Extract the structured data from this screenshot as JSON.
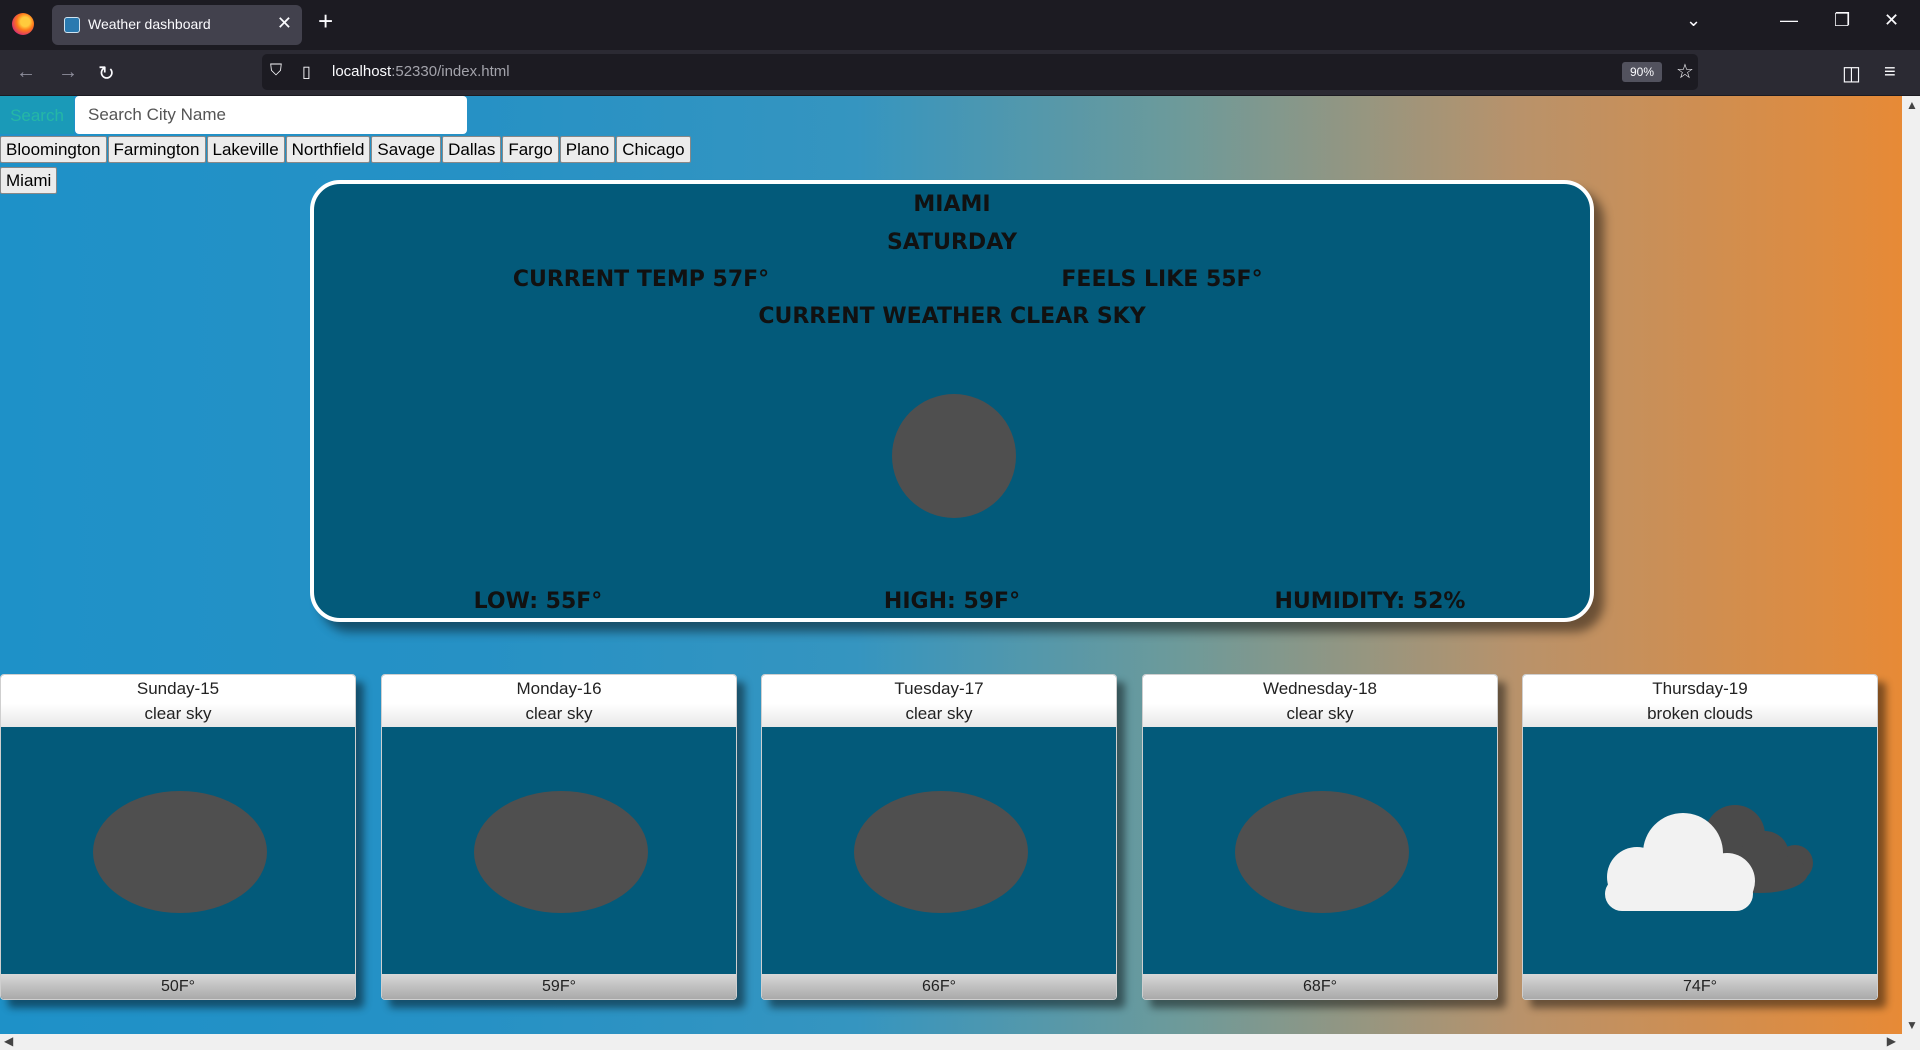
{
  "browser": {
    "tab_title": "Weather dashboard",
    "url_host": "localhost",
    "url_rest": ":52330/index.html",
    "zoom": "90%"
  },
  "search": {
    "button_label": "Search",
    "placeholder": "Search City Name"
  },
  "cities": [
    "Bloomington",
    "Farmington",
    "Lakeville",
    "Northfield",
    "Savage",
    "Dallas",
    "Fargo",
    "Plano",
    "Chicago",
    "Miami"
  ],
  "current": {
    "city": "MIAMI",
    "day": "SATURDAY",
    "temp": "CURRENT TEMP 57F°",
    "feels_like": "FEELS LIKE 55F°",
    "weather": "CURRENT WEATHER CLEAR SKY",
    "low": "LOW: 55F°",
    "high": "HIGH: 59F°",
    "humidity": "HUMIDITY: 52%",
    "icon": "sun-icon"
  },
  "forecast": [
    {
      "day": "Sunday-15",
      "desc": "clear sky",
      "temp": "50F°",
      "icon": "sun-icon"
    },
    {
      "day": "Monday-16",
      "desc": "clear sky",
      "temp": "59F°",
      "icon": "sun-icon"
    },
    {
      "day": "Tuesday-17",
      "desc": "clear sky",
      "temp": "66F°",
      "icon": "sun-icon"
    },
    {
      "day": "Wednesday-18",
      "desc": "clear sky",
      "temp": "68F°",
      "icon": "sun-icon"
    },
    {
      "day": "Thursday-19",
      "desc": "broken clouds",
      "temp": "74F°",
      "icon": "broken-clouds-icon"
    }
  ]
}
